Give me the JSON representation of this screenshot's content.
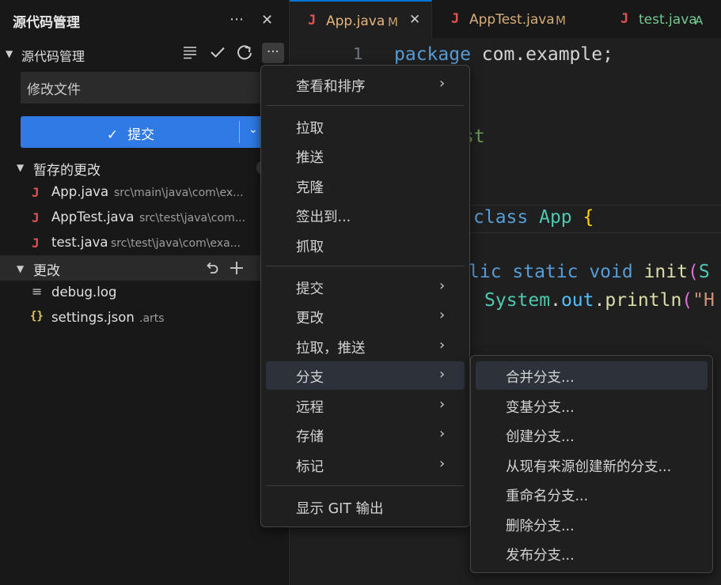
{
  "sidebar": {
    "title": "源代码管理",
    "more_icon": "⋯",
    "close_icon": "✕",
    "section": "源代码管理",
    "commit_input_value": "修改文件",
    "commit_label": "提交",
    "staged": {
      "label": "暂存的更改",
      "files": [
        {
          "icon": "J",
          "name": "App.java",
          "path": "src\\main\\java\\com\\ex..."
        },
        {
          "icon": "J",
          "name": "AppTest.java",
          "path": "src\\test\\java\\com..."
        },
        {
          "icon": "J",
          "name": "test.java",
          "path": "src\\test\\java\\com\\exa..."
        }
      ]
    },
    "changes": {
      "label": "更改",
      "files": [
        {
          "icon": "≡",
          "name": "debug.log",
          "path": ""
        },
        {
          "icon": "{}",
          "name": "settings.json",
          "path": ".arts"
        }
      ]
    }
  },
  "tabs": [
    {
      "icon": "J",
      "name": "App.java",
      "status": "M",
      "active": true
    },
    {
      "icon": "J",
      "name": "AppTest.java",
      "status": "M",
      "active": false
    },
    {
      "icon": "J",
      "name": "test.java",
      "status": "A",
      "active": false
    }
  ],
  "editor": {
    "line_number": "1",
    "kw_package": "package",
    "package_name": " com.example;",
    "frag_st": "st",
    "kw_class": "class",
    "class_name": " App ",
    "brace": "{",
    "frag_lic": "lic",
    "kw_static": " static",
    "kw_void": " void",
    "method": " init",
    "paren": "(",
    "param_S": "S",
    "sys": "System",
    "dot1": ".",
    "out": "out",
    "dot2": ".",
    "println": "println",
    "paren2": "(",
    "str_start": "\"H"
  },
  "main_menu": [
    {
      "label": "查看和排序",
      "submenu": true
    },
    {
      "separator": true
    },
    {
      "label": "拉取",
      "submenu": false
    },
    {
      "label": "推送",
      "submenu": false
    },
    {
      "label": "克隆",
      "submenu": false
    },
    {
      "label": "签出到...",
      "submenu": false
    },
    {
      "label": "抓取",
      "submenu": false
    },
    {
      "separator": true
    },
    {
      "label": "提交",
      "submenu": true
    },
    {
      "label": "更改",
      "submenu": true
    },
    {
      "label": "拉取，推送",
      "submenu": true
    },
    {
      "label": "分支",
      "submenu": true,
      "selected": true
    },
    {
      "label": "远程",
      "submenu": true
    },
    {
      "label": "存储",
      "submenu": true
    },
    {
      "label": "标记",
      "submenu": true
    },
    {
      "separator": true
    },
    {
      "label": "显示 GIT 输出",
      "submenu": false
    }
  ],
  "branch_menu": [
    {
      "label": "合并分支...",
      "selected": true
    },
    {
      "label": "变基分支..."
    },
    {
      "label": "创建分支..."
    },
    {
      "label": "从现有来源创建新的分支..."
    },
    {
      "label": "重命名分支..."
    },
    {
      "label": "删除分支..."
    },
    {
      "label": "发布分支..."
    }
  ],
  "colors": {
    "accent": "#0078d4",
    "commit_button": "#2f7ae5",
    "java_icon": "#e05252",
    "modified": "#c9a26d",
    "added": "#73c991",
    "keyword": "#569cd6",
    "comment": "#6a9955",
    "type": "#4ec9b0",
    "function": "#dcdcaa",
    "string": "#ce9178"
  }
}
